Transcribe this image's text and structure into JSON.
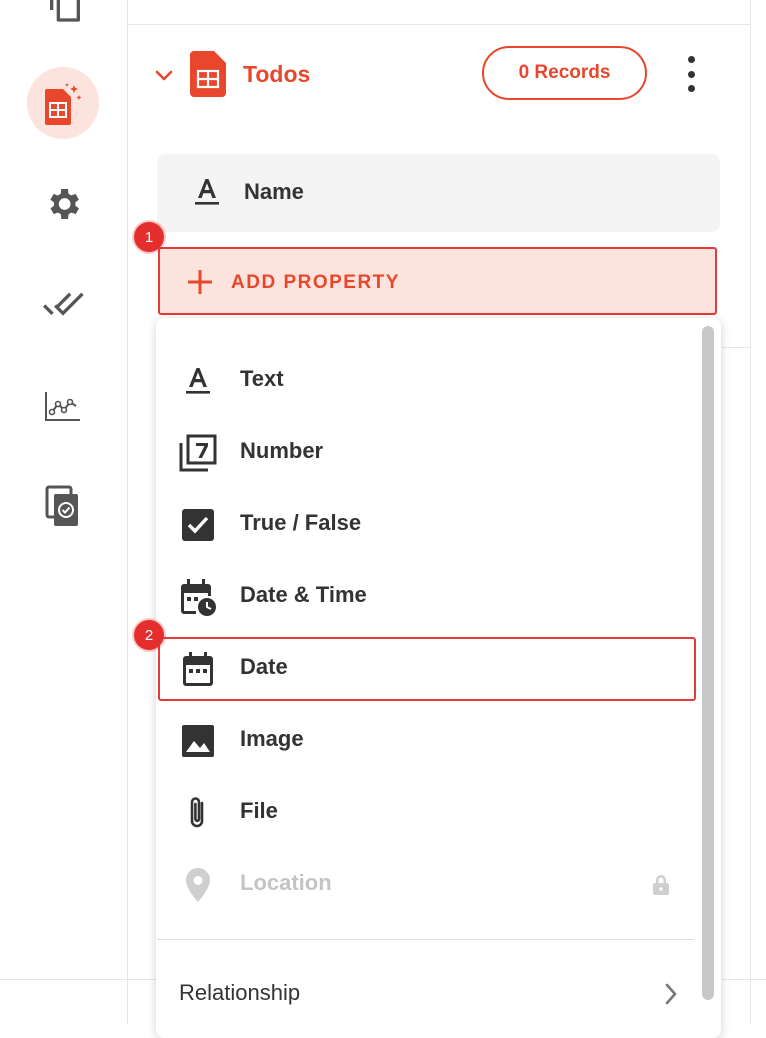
{
  "rail": {
    "items": [
      {
        "icon": "copy-icon"
      },
      {
        "icon": "magic-table-icon",
        "active": true
      },
      {
        "icon": "gear-icon"
      },
      {
        "icon": "done-all-icon"
      },
      {
        "icon": "analytics-icon"
      },
      {
        "icon": "file-check-icon"
      }
    ]
  },
  "table": {
    "title": "Todos",
    "records_label": "0 Records",
    "accent_color": "#e8472c"
  },
  "properties": [
    {
      "icon": "text-format-icon",
      "label": "Name"
    }
  ],
  "add_property": {
    "label": "ADD PROPERTY",
    "step_badge": "1"
  },
  "menu": {
    "items": [
      {
        "icon": "text-format-icon",
        "label": "Text"
      },
      {
        "icon": "number-icon",
        "label": "Number"
      },
      {
        "icon": "checkbox-icon",
        "label": "True / False"
      },
      {
        "icon": "date-time-icon",
        "label": "Date & Time"
      },
      {
        "icon": "calendar-icon",
        "label": "Date",
        "highlighted": true,
        "step_badge": "2"
      },
      {
        "icon": "image-icon",
        "label": "Image"
      },
      {
        "icon": "paperclip-icon",
        "label": "File"
      },
      {
        "icon": "location-icon",
        "label": "Location",
        "locked": true
      }
    ],
    "relationship_label": "Relationship"
  }
}
